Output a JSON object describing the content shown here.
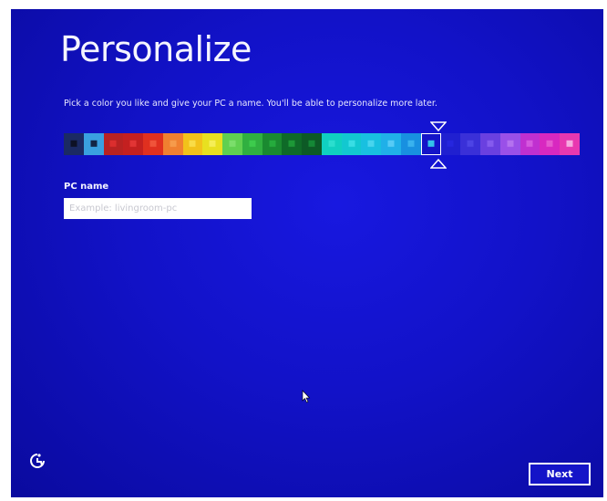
{
  "page": {
    "title": "Personalize",
    "subtitle": "Pick a color you like and give your PC a name. You'll be able to personalize more later."
  },
  "colors": {
    "selected_index": 18,
    "swatches": [
      {
        "bg": "#1b2a63",
        "chip": "#0b0d1a"
      },
      {
        "bg": "#3aa0e0",
        "chip": "#0c0f2a"
      },
      {
        "bg": "#b82222",
        "chip": "#e03030"
      },
      {
        "bg": "#c42020",
        "chip": "#e83a3a"
      },
      {
        "bg": "#e0301f",
        "chip": "#f25a40"
      },
      {
        "bg": "#f08030",
        "chip": "#f7a050"
      },
      {
        "bg": "#f2c21a",
        "chip": "#fae050"
      },
      {
        "bg": "#e8e020",
        "chip": "#f7f060"
      },
      {
        "bg": "#60d050",
        "chip": "#80e070"
      },
      {
        "bg": "#30b040",
        "chip": "#40d050"
      },
      {
        "bg": "#1a8a30",
        "chip": "#28b040"
      },
      {
        "bg": "#0f6a28",
        "chip": "#20a03a"
      },
      {
        "bg": "#0d5a26",
        "chip": "#18903a"
      },
      {
        "bg": "#10d0c0",
        "chip": "#30e0d0"
      },
      {
        "bg": "#12c8d0",
        "chip": "#40e0e8"
      },
      {
        "bg": "#18c0e0",
        "chip": "#50d8f0"
      },
      {
        "bg": "#20b0e8",
        "chip": "#60d0f8"
      },
      {
        "bg": "#1890e0",
        "chip": "#40b8f0"
      },
      {
        "bg": "#1414c8",
        "chip": "#38e0f0"
      },
      {
        "bg": "#2020d0",
        "chip": "#2828e0"
      },
      {
        "bg": "#3a30d8",
        "chip": "#5048e8"
      },
      {
        "bg": "#6a40e0",
        "chip": "#8a60f0"
      },
      {
        "bg": "#9a50e8",
        "chip": "#b878f0"
      },
      {
        "bg": "#c030d0",
        "chip": "#d860e0"
      },
      {
        "bg": "#d828c0",
        "chip": "#e860d0"
      },
      {
        "bg": "#e838b0",
        "chip": "#f8c0e8"
      }
    ]
  },
  "pc_name": {
    "label": "PC name",
    "placeholder": "Example: livingroom-pc",
    "value": ""
  },
  "footer": {
    "ease_of_access_icon": "ease-of-access-icon",
    "next_label": "Next"
  },
  "theme": {
    "background": "#1212c8",
    "text": "#ffffff"
  }
}
